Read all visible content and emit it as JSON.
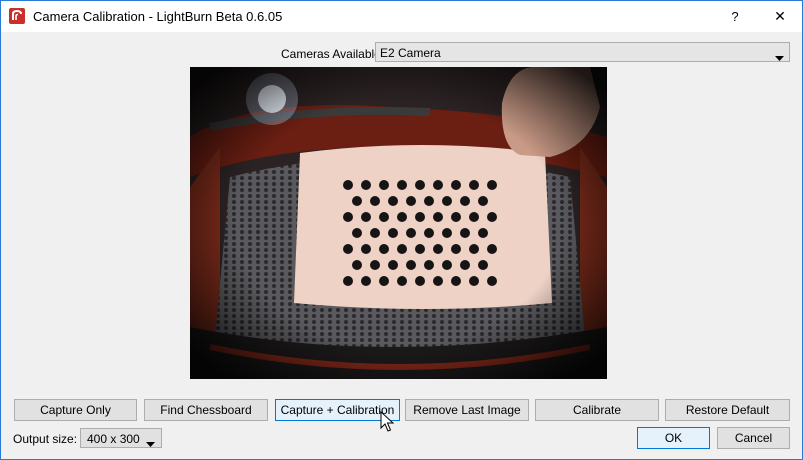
{
  "window": {
    "title": "Camera Calibration - LightBurn Beta 0.6.05",
    "help_label": "?",
    "close_label": "✕"
  },
  "cameras": {
    "label": "Cameras Available:",
    "selected": "E2 Camera"
  },
  "buttons": {
    "capture_only": "Capture Only",
    "find_chessboard": "Find Chessboard",
    "capture_calibration": "Capture + Calibration",
    "remove_last_image": "Remove Last Image",
    "calibrate": "Calibrate",
    "restore_default": "Restore Default",
    "ok": "OK",
    "cancel": "Cancel"
  },
  "output": {
    "label": "Output size:",
    "selected": "400 x 300"
  },
  "colors": {
    "accent": "#0078d7",
    "logo_red": "#c8312b"
  }
}
